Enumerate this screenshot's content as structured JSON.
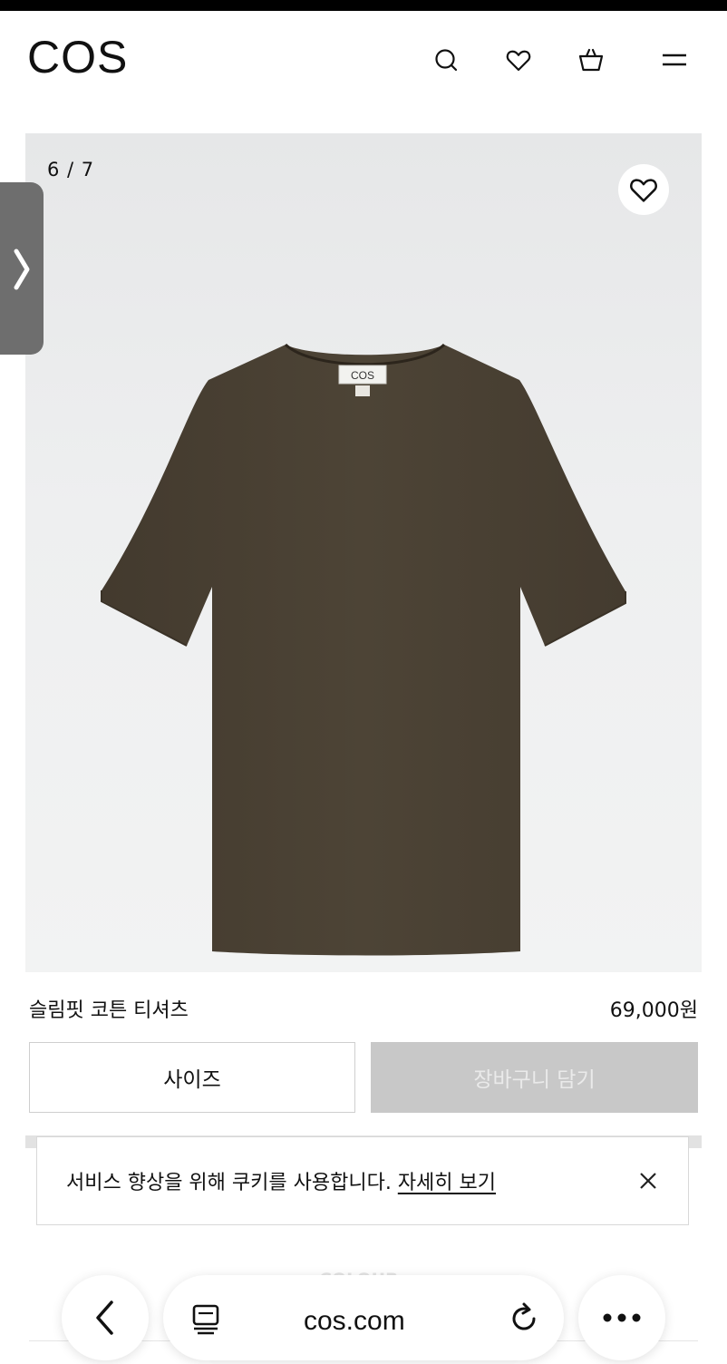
{
  "header": {
    "logo": "COS",
    "icons": [
      "search-icon",
      "heart-icon",
      "bag-icon",
      "menu-icon"
    ]
  },
  "gallery": {
    "counter": "6 / 7",
    "garment_label": "COS",
    "garment_color": "#4a4133",
    "background_color": "#eceded"
  },
  "product": {
    "name": "슬림핏 코튼 티셔츠",
    "price": "69,000원"
  },
  "actions": {
    "size_label": "사이즈",
    "add_to_cart_label": "장바구니 담기"
  },
  "cookie": {
    "message": "서비스 향상을 위해 쿠키를 사용합니다. ",
    "link_label": "자세히 보기"
  },
  "background_text": {
    "line1": "",
    "line2": "COLOUR"
  },
  "browser": {
    "url": "cos.com"
  }
}
